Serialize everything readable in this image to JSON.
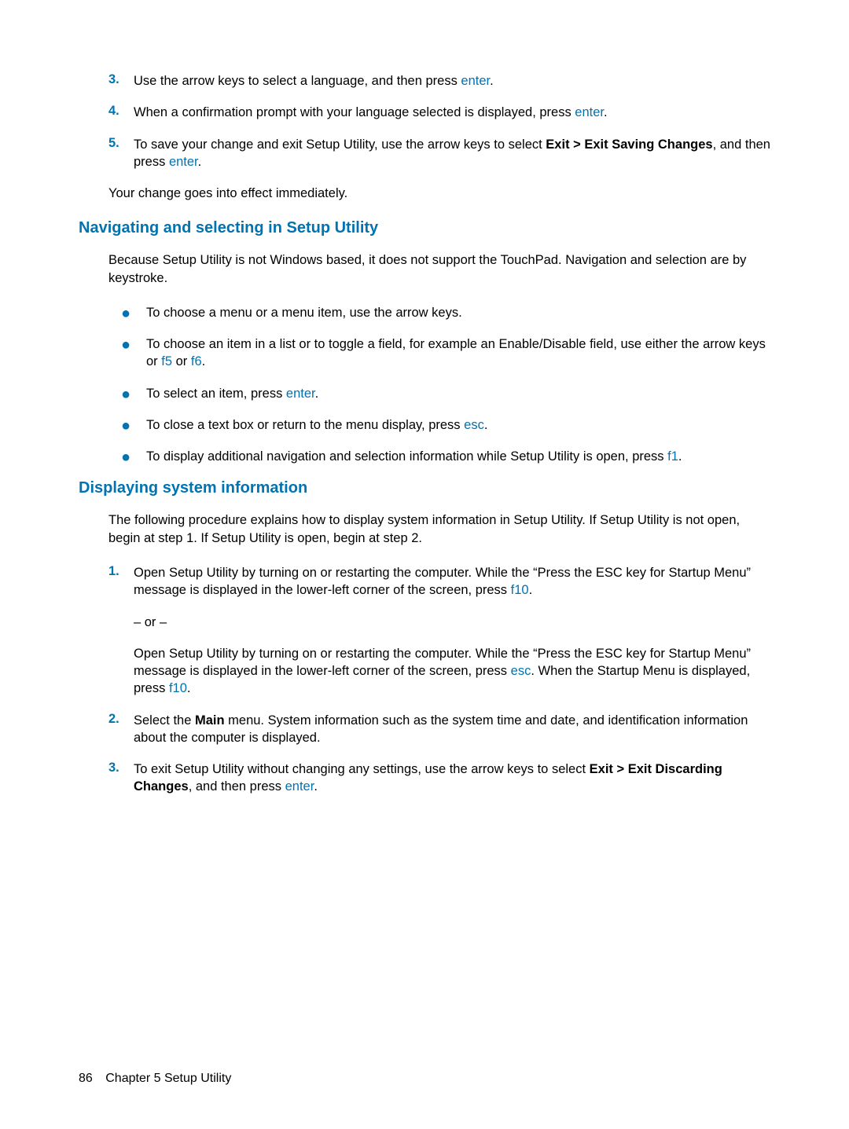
{
  "topList": {
    "items": [
      {
        "num": "3.",
        "pre": "Use the arrow keys to select a language, and then press ",
        "key": "enter",
        "post": "."
      },
      {
        "num": "4.",
        "pre": "When a confirmation prompt with your language selected is displayed, press ",
        "key": "enter",
        "post": "."
      },
      {
        "num": "5.",
        "pre": "To save your change and exit Setup Utility, use the arrow keys to select ",
        "bold": "Exit > Exit Saving Changes",
        "mid": ", and then press ",
        "key": "enter",
        "post": "."
      }
    ]
  },
  "topNote": "Your change goes into effect immediately.",
  "sectionA": {
    "heading": "Navigating and selecting in Setup Utility",
    "intro": "Because Setup Utility is not Windows based, it does not support the TouchPad. Navigation and selection are by keystroke.",
    "bullets": [
      {
        "text": "To choose a menu or a menu item, use the arrow keys."
      },
      {
        "pre": "To choose an item in a list or to toggle a field, for example an Enable/Disable field, use either the arrow keys or ",
        "key1": "f5",
        "mid": " or ",
        "key2": "f6",
        "post": "."
      },
      {
        "pre": "To select an item, press ",
        "key1": "enter",
        "post": "."
      },
      {
        "pre": "To close a text box or return to the menu display, press ",
        "key1": "esc",
        "post": "."
      },
      {
        "pre": "To display additional navigation and selection information while Setup Utility is open, press ",
        "key1": "f1",
        "post": "."
      }
    ]
  },
  "sectionB": {
    "heading": "Displaying system information",
    "intro": "The following procedure explains how to display system information in Setup Utility. If Setup Utility is not open, begin at step 1. If Setup Utility is open, begin at step 2.",
    "items": [
      {
        "num": "1.",
        "p1pre": "Open Setup Utility by turning on or restarting the computer. While the “Press the ESC key for Startup Menu” message is displayed in the lower-left corner of the screen, press ",
        "p1key": "f10",
        "p1post": ".",
        "or": "– or –",
        "p2pre": "Open Setup Utility by turning on or restarting the computer. While the “Press the ESC key for Startup Menu” message is displayed in the lower-left corner of the screen, press ",
        "p2key1": "esc",
        "p2mid": ". When the Startup Menu is displayed, press ",
        "p2key2": "f10",
        "p2post": "."
      },
      {
        "num": "2.",
        "pre": "Select the ",
        "bold": "Main",
        "post": " menu. System information such as the system time and date, and identification information about the computer is displayed."
      },
      {
        "num": "3.",
        "pre": "To exit Setup Utility without changing any settings, use the arrow keys to select ",
        "bold": "Exit > Exit Discarding Changes",
        "mid": ", and then press ",
        "key": "enter",
        "post": "."
      }
    ]
  },
  "footer": {
    "pageNum": "86",
    "chapter": "Chapter 5   Setup Utility"
  }
}
